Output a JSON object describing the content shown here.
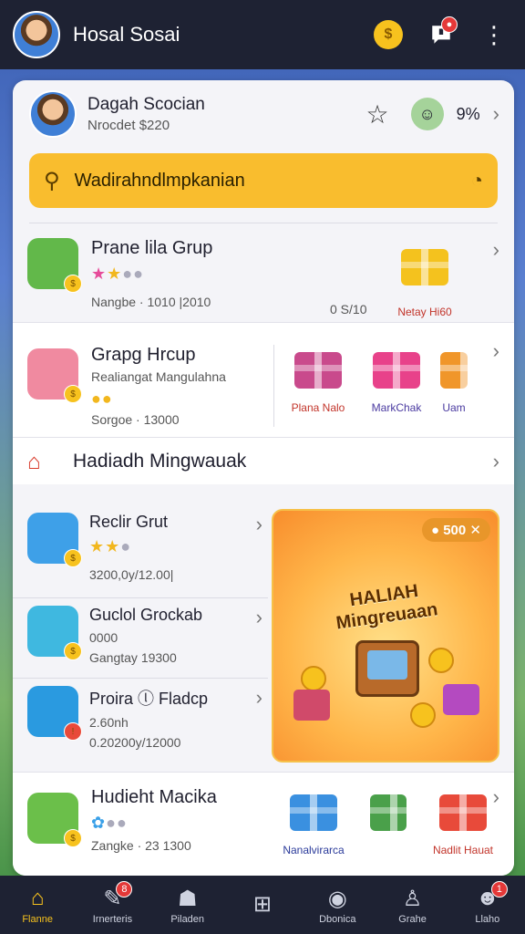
{
  "topbar": {
    "title": "Hosal Sosai",
    "notif_badge": ""
  },
  "profile": {
    "name": "Dagah Scocian",
    "sub": "Nrocdet $220",
    "percent": "9%"
  },
  "search": {
    "text": "Wadirahndlmpkanian"
  },
  "group1": {
    "name": "Prane lila Grup",
    "meta": "Nangbe · 1010 |2010",
    "count": "0 S/10",
    "gift_label": "Netay Hi60"
  },
  "group2": {
    "name": "Grapg Hrcup",
    "sub": "Realiangat Mangulahna",
    "meta": "Sorgoe · 13000",
    "gifts": [
      "Plana Nalo",
      "MarkChak",
      "Uam"
    ]
  },
  "section": {
    "title": "Hadiadh Mingwauak"
  },
  "list": [
    {
      "name": "Reclir Grut",
      "meta": "3200,0y/12.00|"
    },
    {
      "name": "Guclol Grockab",
      "sub": "0000",
      "meta": "Gangtay 19300"
    },
    {
      "name": "Proira ⓛ Fladcp",
      "sub": "2.60nh",
      "meta": "0.20200y/12000"
    }
  ],
  "promo": {
    "pill": "500",
    "title_line1": "HALIAH",
    "title_line2": "Mingreuaan"
  },
  "group3": {
    "name": "Hudieht Macika",
    "meta": "Zangke · 23 1300",
    "gifts": [
      "Nanalvirarca",
      "Nadlit Hauat"
    ]
  },
  "nav": [
    {
      "label": "Flanne"
    },
    {
      "label": "Irnerteris",
      "badge": "8"
    },
    {
      "label": "Piladen"
    },
    {
      "label": ""
    },
    {
      "label": "Dbonica"
    },
    {
      "label": "Grahe"
    },
    {
      "label": "Llaho",
      "badge": "1"
    }
  ]
}
